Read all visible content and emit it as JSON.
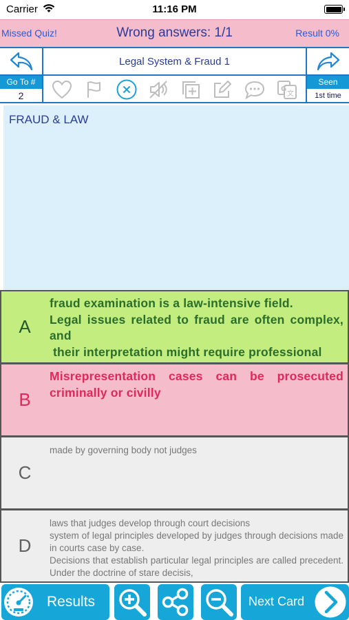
{
  "status_bar": {
    "carrier": "Carrier",
    "time": "11:16 PM"
  },
  "header": {
    "missed": "Missed Quiz!",
    "title": "Wrong answers: 1/1",
    "result": "Result 0%"
  },
  "nav": {
    "quiz_title": "Legal System & Fraud 1"
  },
  "toolbar": {
    "goto_label": "Go To #",
    "goto_value": "2",
    "seen_label": "Seen",
    "seen_value": "1st time",
    "icons": [
      "heart-icon",
      "flag-icon",
      "close-circle-icon",
      "mute-speaker-icon",
      "add-copy-icon",
      "edit-icon",
      "chat-icon",
      "translate-icon"
    ]
  },
  "question": {
    "text": "FRAUD & LAW"
  },
  "answers": [
    {
      "letter": "A",
      "lines": [
        "fraud examination is a law-intensive field.",
        "Legal issues related to fraud are often complex, and",
        "their interpretation might require professional"
      ]
    },
    {
      "letter": "B",
      "lines": [
        "Misrepresentation cases can be prosecuted criminally or civilly"
      ]
    },
    {
      "letter": "C",
      "lines": [
        "made by governing body not judges"
      ]
    },
    {
      "letter": "D",
      "lines": [
        "laws that judges develop through court decisions",
        "system of legal principles developed by judges through decisions made in courts case by case.",
        "Decisions that establish particular legal principles are called precedent. Under the doctrine of stare decisis,"
      ]
    }
  ],
  "bottom": {
    "results_label": "Results",
    "next_label": "Next Card"
  },
  "colors": {
    "accent_blue": "#17a6d8",
    "pink": "#f5bccb",
    "green": "#c3ed7e",
    "light_blue": "#dcf0fb"
  }
}
